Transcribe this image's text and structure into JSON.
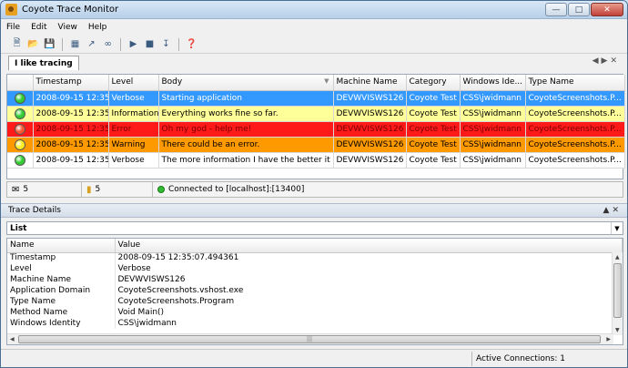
{
  "window": {
    "title": "Coyote Trace Monitor"
  },
  "menu": [
    "File",
    "Edit",
    "View",
    "Help"
  ],
  "document_tab": {
    "label": "I like tracing"
  },
  "grid": {
    "columns": [
      "",
      "Timestamp",
      "Level",
      "Body",
      "Machine Name",
      "Category",
      "Windows Ide...",
      "Type Name"
    ],
    "rows": [
      {
        "color": "#3399ff",
        "text_color": "#ffffff",
        "dot": "#33cc33",
        "timestamp": "2008-09-15 12:35...",
        "level": "Verbose",
        "body": "Starting application",
        "machine": "DEVWVISWS126",
        "category": "Coyote Test",
        "identity": "CSS\\jwidmann",
        "type": "CoyoteScreenshots.P..."
      },
      {
        "color": "#ffff99",
        "text_color": "#000000",
        "dot": "#33cc33",
        "timestamp": "2008-09-15 12:35...",
        "level": "Information",
        "body": "Everything works fine so far.",
        "machine": "DEVWVISWS126",
        "category": "Coyote Test",
        "identity": "CSS\\jwidmann",
        "type": "CoyoteScreenshots.P..."
      },
      {
        "color": "#ff1a1a",
        "text_color": "#7a0000",
        "dot": "#ff5533",
        "timestamp": "2008-09-15 12:35...",
        "level": "Error",
        "body": "Oh my god - help me!",
        "machine": "DEVWVISWS126",
        "category": "Coyote Test",
        "identity": "CSS\\jwidmann",
        "type": "CoyoteScreenshots.P..."
      },
      {
        "color": "#ff9900",
        "text_color": "#000000",
        "dot": "#ffee22",
        "timestamp": "2008-09-15 12:35...",
        "level": "Warning",
        "body": "There could be an error.",
        "machine": "DEVWVISWS126",
        "category": "Coyote Test",
        "identity": "CSS\\jwidmann",
        "type": "CoyoteScreenshots.P..."
      },
      {
        "color": "#ffffff",
        "text_color": "#000000",
        "dot": "#33cc33",
        "timestamp": "2008-09-15 12:35...",
        "level": "Verbose",
        "body": "The more information I have the better it is.",
        "machine": "DEVWVISWS126",
        "category": "Coyote Test",
        "identity": "CSS\\jwidmann",
        "type": "CoyoteScreenshots.P..."
      }
    ]
  },
  "status_strip": {
    "messages_count": "5",
    "files_count": "5",
    "connection": "Connected to [localhost]:[13400]"
  },
  "trace_details": {
    "title": "Trace Details",
    "view_mode": "List",
    "columns": [
      "Name",
      "Value"
    ],
    "properties": [
      {
        "name": "Timestamp",
        "value": "2008-09-15 12:35:07.494361"
      },
      {
        "name": "Level",
        "value": "Verbose"
      },
      {
        "name": "Machine Name",
        "value": "DEVWVISWS126"
      },
      {
        "name": "Application Domain",
        "value": "CoyoteScreenshots.vshost.exe"
      },
      {
        "name": "Type Name",
        "value": "CoyoteScreenshots.Program"
      },
      {
        "name": "Method Name",
        "value": "Void Main()"
      },
      {
        "name": "Windows Identity",
        "value": "CSS\\jwidmann"
      }
    ]
  },
  "bottom_status": {
    "connections": "Active Connections: 1"
  }
}
